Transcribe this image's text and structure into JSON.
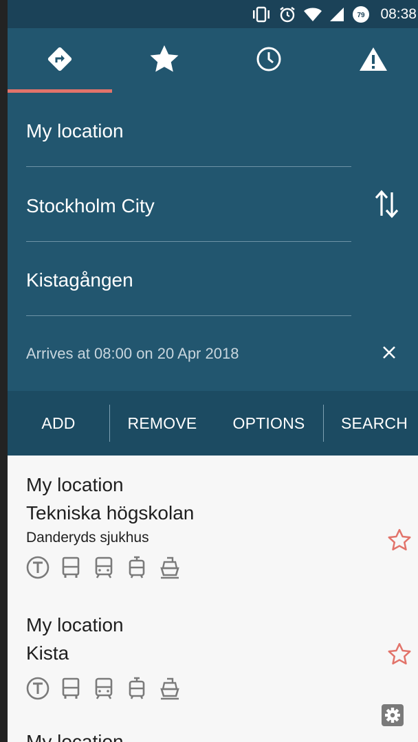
{
  "status_bar": {
    "time": "08:38",
    "battery_level": "79",
    "icons": [
      "vibrate-icon",
      "alarm-icon",
      "wifi-icon",
      "signal-icon",
      "battery-icon"
    ]
  },
  "tabs": [
    {
      "name": "directions",
      "icon": "directions-icon",
      "selected": true
    },
    {
      "name": "favorites",
      "icon": "star-icon",
      "selected": false
    },
    {
      "name": "history",
      "icon": "clock-icon",
      "selected": false
    },
    {
      "name": "deviations",
      "icon": "warning-icon",
      "selected": false
    }
  ],
  "planner": {
    "from": "My location",
    "via": "Stockholm City",
    "to": "Kistagången",
    "arrives": "Arrives at 08:00 on 20 Apr 2018"
  },
  "actions": {
    "add": "ADD",
    "remove": "REMOVE",
    "options": "OPTIONS",
    "search": "SEARCH"
  },
  "trips": [
    {
      "from": "My location",
      "to": "Tekniska högskolan",
      "via": "Danderyds sjukhus",
      "starred": false,
      "modes": [
        "metro-icon",
        "bus-icon",
        "train-icon",
        "tram-icon",
        "ferry-icon"
      ]
    },
    {
      "from": "My location",
      "to": "Kista",
      "starred": false,
      "modes": [
        "metro-icon",
        "bus-icon",
        "train-icon",
        "tram-icon",
        "ferry-icon"
      ]
    },
    {
      "from": "My location"
    }
  ],
  "colors": {
    "panel": "#22566f",
    "status_bar": "#1b4258",
    "action_bar": "#1c4b62",
    "accent": "#e2736a",
    "icon_grey": "#7a7a7a"
  }
}
